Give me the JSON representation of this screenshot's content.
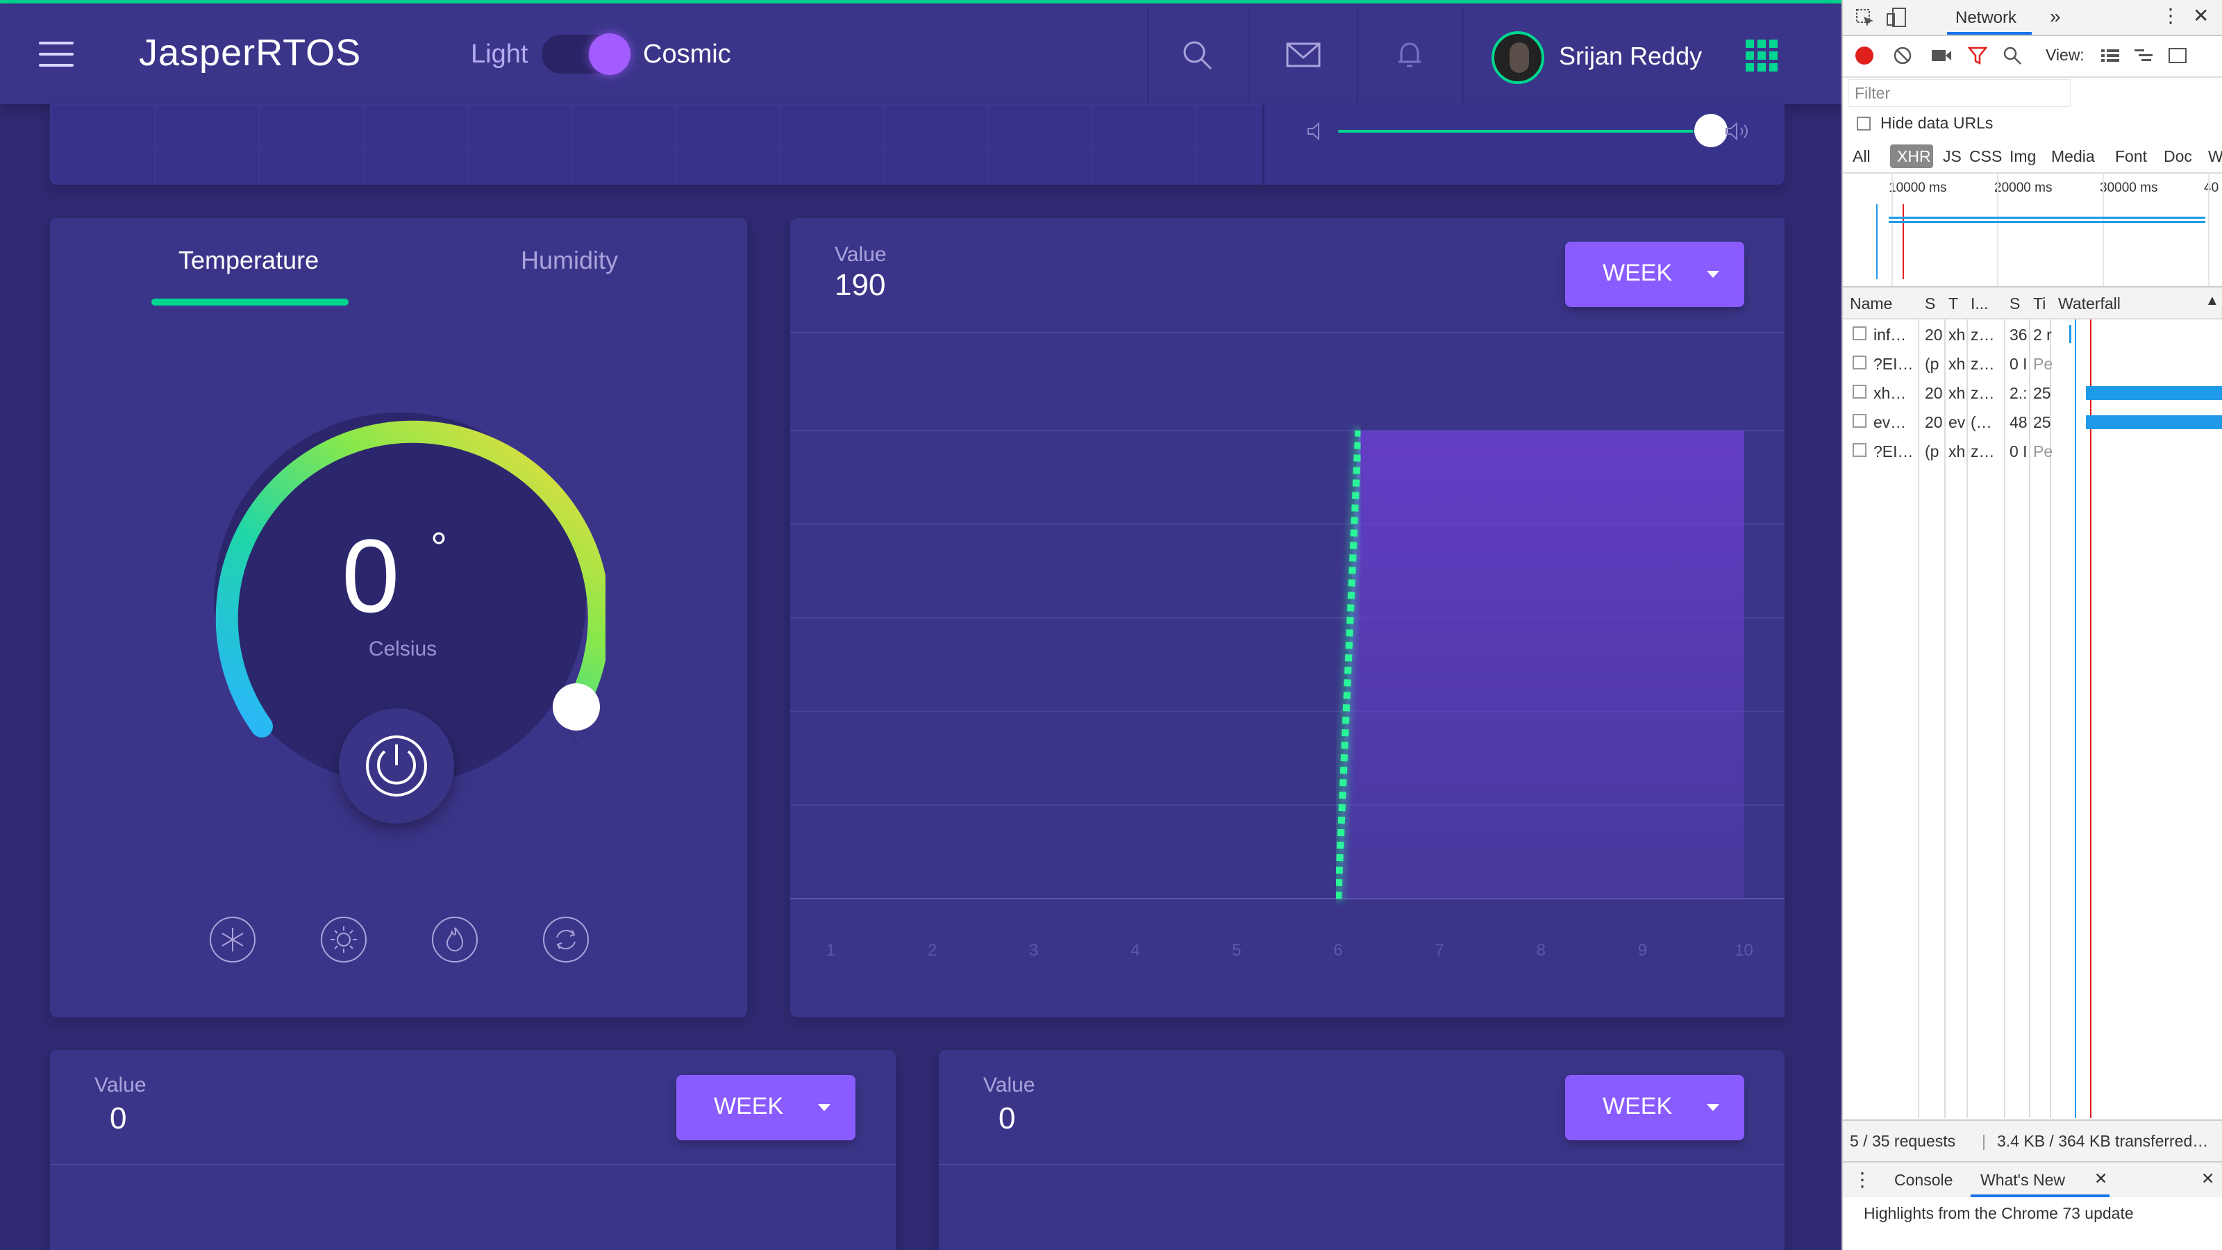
{
  "header": {
    "logo": "JasperRTOS",
    "theme_left_label": "Light",
    "theme_right_label": "Cosmic",
    "user_name": "Srijan Reddy"
  },
  "temperature_card": {
    "tabs": [
      "Temperature",
      "Humidity"
    ],
    "active_tab": "Temperature",
    "value": "0",
    "degree_symbol": "°",
    "unit": "Celsius"
  },
  "main_chart": {
    "value_label": "Value",
    "value": "190",
    "period_button": "WEEK",
    "x_ticks": [
      "1",
      "2",
      "3",
      "4",
      "5",
      "6",
      "7",
      "8",
      "9",
      "10"
    ]
  },
  "chart_data": {
    "type": "line",
    "x": [
      1,
      2,
      3,
      4,
      5,
      6,
      6.2,
      7,
      8,
      9,
      10
    ],
    "series": [
      {
        "values": [
          0,
          0,
          0,
          0,
          0,
          0,
          190,
          190,
          190,
          190,
          190
        ]
      }
    ],
    "xlim": [
      0.6,
      10.4
    ],
    "ylim": [
      0,
      190
    ],
    "grid": true,
    "colors": {
      "line_low": "#e8ff3a",
      "line_high": "#2af598",
      "fill": "#6a3fd0"
    }
  },
  "bottom_left": {
    "value_label": "Value",
    "value": "0",
    "period_button": "WEEK"
  },
  "bottom_right": {
    "value_label": "Value",
    "value": "0",
    "period_button": "WEEK"
  },
  "devtools": {
    "panel_tab": "Network",
    "view_label": "View:",
    "filter_placeholder": "Filter",
    "hide_data_urls": "Hide data URLs",
    "type_filters": [
      "All",
      "XHR",
      "JS",
      "CSS",
      "Img",
      "Media",
      "Font",
      "Doc",
      "W"
    ],
    "active_type": "XHR",
    "timeline_ticks": [
      "10000 ms",
      "20000 ms",
      "30000 ms",
      "40"
    ],
    "columns": [
      "Name",
      "S",
      "T",
      "I...",
      "S",
      "Ti",
      "Waterfall"
    ],
    "rows": [
      {
        "name": "inf…",
        "status": "20",
        "type": "xh",
        "initiator": "z…",
        "size": "36",
        "time": "2 r"
      },
      {
        "name": "?EI…",
        "status": "(p",
        "type": "xh",
        "initiator": "z…",
        "size": "0 I",
        "time": "Pe"
      },
      {
        "name": "xh…",
        "status": "20",
        "type": "xh",
        "initiator": "z…",
        "size": "2.:",
        "time": "25"
      },
      {
        "name": "ev…",
        "status": "20",
        "type": "ev",
        "initiator": "(…",
        "size": "48",
        "time": "25"
      },
      {
        "name": "?EI…",
        "status": "(p",
        "type": "xh",
        "initiator": "z…",
        "size": "0 I",
        "time": "Pe"
      }
    ],
    "summary_requests": "5 / 35 requests",
    "summary_transfer": "3.4 KB / 364 KB transferred…",
    "drawer_tabs": [
      "Console",
      "What's New"
    ],
    "drawer_message": "Highlights from the Chrome 73 update",
    "accent_colors": {
      "record": "#e0201c",
      "bar": "#1e9ae8"
    }
  },
  "colors": {
    "accent_green": "#00d68f",
    "primary_purple": "#8a5cff",
    "background": "#2f2a72",
    "card": "#3b3589"
  }
}
